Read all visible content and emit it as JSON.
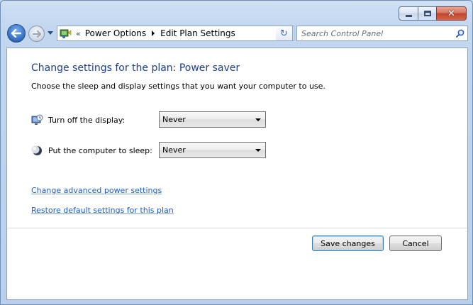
{
  "window": {
    "close_glyph": "✕"
  },
  "navigation": {
    "address_chevron": "«",
    "breadcrumbs": [
      "Power Options",
      "Edit Plan Settings"
    ],
    "refresh_glyph": "↻",
    "search_placeholder": "Search Control Panel"
  },
  "content": {
    "heading": "Change settings for the plan: Power saver",
    "description": "Choose the sleep and display settings that you want your computer to use.",
    "settings": [
      {
        "label": "Turn off the display:",
        "value": "Never",
        "icon": "monitor-icon"
      },
      {
        "label": "Put the computer to sleep:",
        "value": "Never",
        "icon": "moon-icon"
      }
    ],
    "links": [
      "Change advanced power settings",
      "Restore default settings for this plan"
    ],
    "buttons": {
      "save": "Save changes",
      "cancel": "Cancel"
    }
  },
  "colors": {
    "heading": "#1e3f8a",
    "link": "#1d5bc4",
    "frame": "#bcd3ec"
  }
}
